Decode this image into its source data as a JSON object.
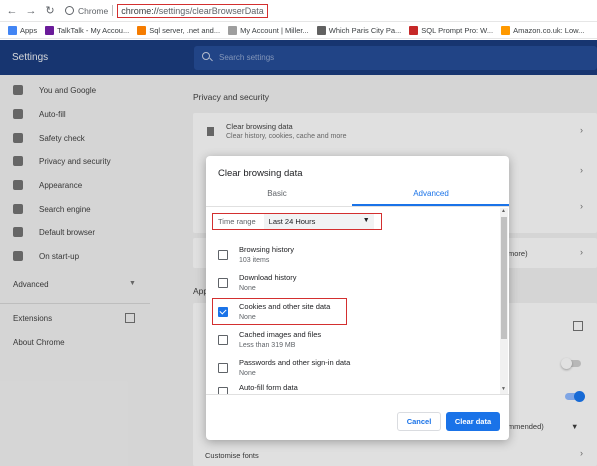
{
  "browser": {
    "site_label": "Chrome",
    "url_scheme": "chrome://",
    "url_path": "settings/clearBrowserData"
  },
  "bookmarks": [
    {
      "label": "Apps",
      "color": "#4285f4"
    },
    {
      "label": "TalkTalk - My Accou...",
      "color": "#6a1b9a"
    },
    {
      "label": "Sql server, .net and...",
      "color": "#f57c00"
    },
    {
      "label": "My Account | Miller...",
      "color": "#9e9e9e"
    },
    {
      "label": "Which Paris City Pa...",
      "color": "#616161"
    },
    {
      "label": "SQL Prompt Pro: W...",
      "color": "#c62828"
    },
    {
      "label": "Amazon.co.uk: Low...",
      "color": "#ff9900"
    }
  ],
  "header": {
    "title": "Settings",
    "search_placeholder": "Search settings"
  },
  "sidebar": {
    "items": [
      {
        "label": "You and Google",
        "icon": "person-icon"
      },
      {
        "label": "Auto-fill",
        "icon": "clipboard-icon"
      },
      {
        "label": "Safety check",
        "icon": "shield-check-icon"
      },
      {
        "label": "Privacy and security",
        "icon": "shield-icon"
      },
      {
        "label": "Appearance",
        "icon": "palette-icon"
      },
      {
        "label": "Search engine",
        "icon": "search-icon"
      },
      {
        "label": "Default browser",
        "icon": "browser-icon"
      },
      {
        "label": "On start-up",
        "icon": "power-icon"
      }
    ],
    "advanced": "Advanced",
    "extensions": "Extensions",
    "about": "About Chrome"
  },
  "main": {
    "section_title": "Privacy and security",
    "clear_row_title": "Clear browsing data",
    "clear_row_sub": "Clear history, cookies, cache and more",
    "partial_more": "more)",
    "appearance_prefix": "App",
    "recommended_partial": "commended)",
    "customise_fonts": "Customise fonts"
  },
  "dialog": {
    "title": "Clear browsing data",
    "tab_basic": "Basic",
    "tab_advanced": "Advanced",
    "time_range_label": "Time range",
    "time_range_value": "Last 24 Hours",
    "options": [
      {
        "title": "Browsing history",
        "sub": "103 items",
        "checked": false
      },
      {
        "title": "Download history",
        "sub": "None",
        "checked": false
      },
      {
        "title": "Cookies and other site data",
        "sub": "None",
        "checked": true
      },
      {
        "title": "Cached images and files",
        "sub": "Less than 319 MB",
        "checked": false
      },
      {
        "title": "Passwords and other sign-in data",
        "sub": "None",
        "checked": false
      },
      {
        "title": "Auto-fill form data",
        "sub": "",
        "checked": false
      }
    ],
    "cancel": "Cancel",
    "clear": "Clear data"
  }
}
